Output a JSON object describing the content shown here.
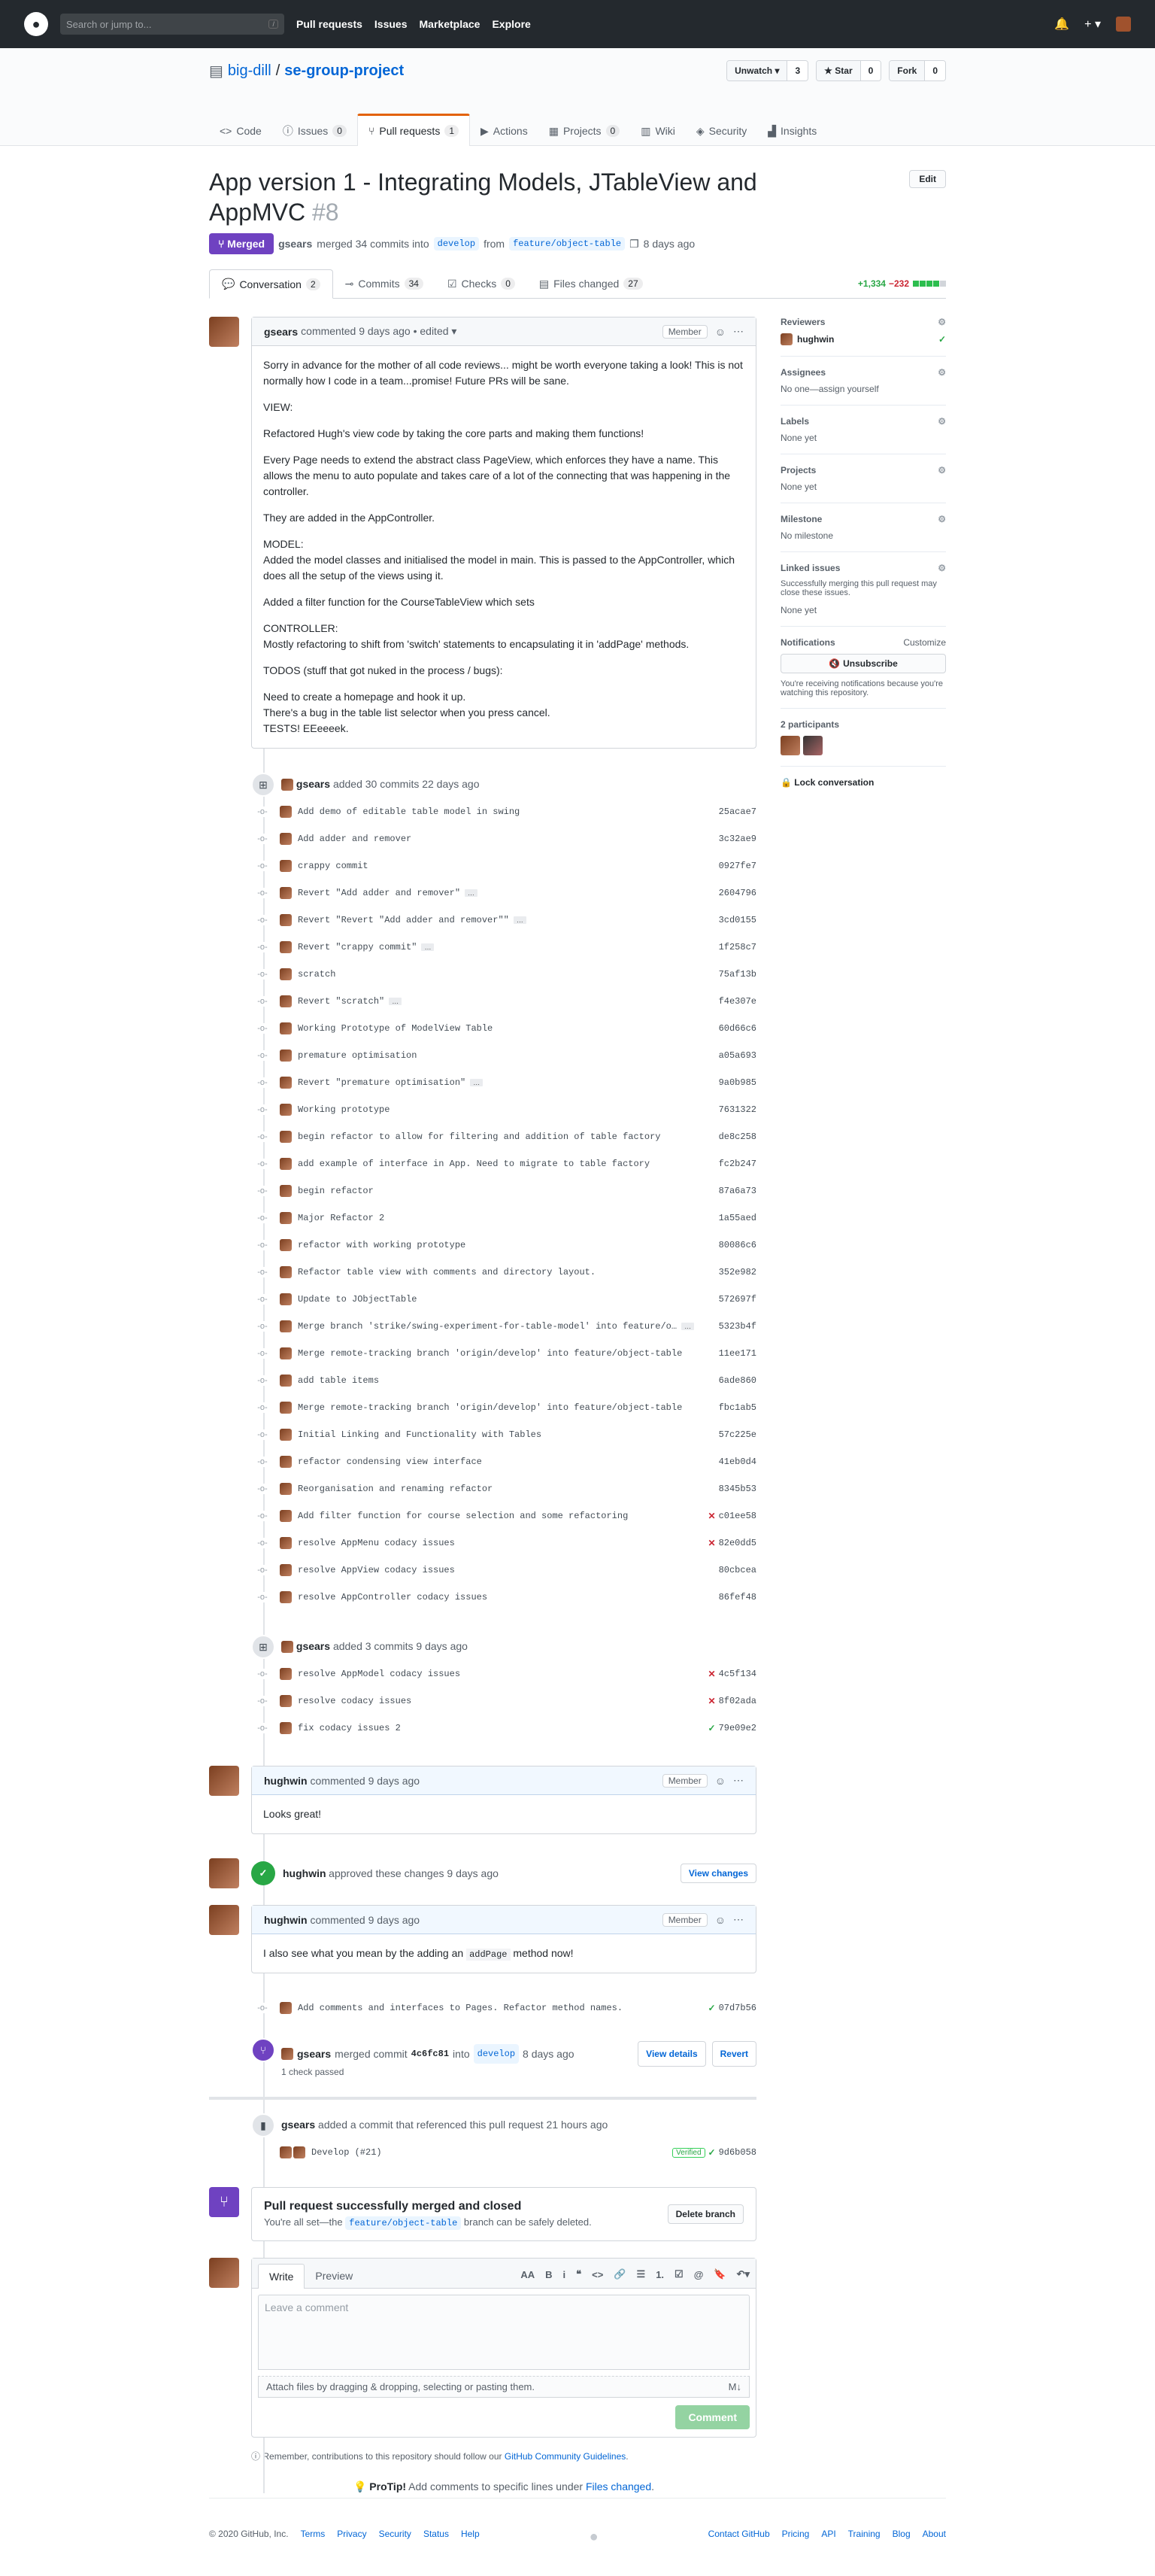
{
  "header": {
    "search_placeholder": "Search or jump to...",
    "search_key": "/",
    "nav": [
      "Pull requests",
      "Issues",
      "Marketplace",
      "Explore"
    ],
    "plus": "+ ▾"
  },
  "repo": {
    "owner": "big-dill",
    "sep": "/",
    "name": "se-group-project",
    "watch_label": "Unwatch ▾",
    "watch_count": "3",
    "star_label": "★ Star",
    "star_count": "0",
    "fork_label": "Fork",
    "fork_count": "0"
  },
  "repo_tabs": [
    {
      "label": "Code",
      "count": ""
    },
    {
      "label": "Issues",
      "count": "0"
    },
    {
      "label": "Pull requests",
      "count": "1"
    },
    {
      "label": "Actions",
      "count": ""
    },
    {
      "label": "Projects",
      "count": "0"
    },
    {
      "label": "Wiki",
      "count": ""
    },
    {
      "label": "Security",
      "count": ""
    },
    {
      "label": "Insights",
      "count": ""
    }
  ],
  "pr": {
    "title": "App version 1 - Integrating Models, JTableView and AppMVC",
    "number": "#8",
    "edit": "Edit",
    "state": "Merged",
    "author": "gsears",
    "merged_text": "merged 34 commits into",
    "base": "develop",
    "from": "from",
    "head": "feature/object-table",
    "ago": "8 days ago"
  },
  "pr_tabs": [
    {
      "label": "Conversation",
      "count": "2"
    },
    {
      "label": "Commits",
      "count": "34"
    },
    {
      "label": "Checks",
      "count": "0"
    },
    {
      "label": "Files changed",
      "count": "27"
    }
  ],
  "diffstat": {
    "add": "+1,334",
    "del": "−232"
  },
  "first_comment": {
    "author": "gsears",
    "meta": "commented 9 days ago • edited ▾",
    "role": "Member",
    "paragraphs": [
      "Sorry in advance for the mother of all code reviews... might be worth everyone taking a look! This is not normally how I code in a team...promise! Future PRs will be sane.",
      "VIEW:",
      "Refactored Hugh's view code by taking the core parts and making them functions!",
      "Every Page needs to extend the abstract class PageView, which enforces they have a name. This allows the menu to auto populate and takes care of a lot of the connecting that was happening in the controller.",
      "They are added in the AppController.",
      "MODEL:\nAdded the model classes and initialised the model in main. This is passed to the AppController, which does all the setup of the views using it.",
      "Added a filter function for the CourseTableView which sets",
      "CONTROLLER:\nMostly refactoring to shift from 'switch' statements to encapsulating it in 'addPage' methods.",
      "TODOS (stuff that got nuked in the process / bugs):",
      "Need to create a homepage and hook it up.\nThere's a bug in the table list selector when you press cancel.\nTESTS! EEeeeek."
    ]
  },
  "commit_group1": {
    "author": "gsears",
    "text": "added 30 commits 22 days ago",
    "commits": [
      {
        "msg": "Add demo of editable table model in swing",
        "ell": false,
        "sha": "25acae7",
        "status": ""
      },
      {
        "msg": "Add adder and remover",
        "ell": false,
        "sha": "3c32ae9",
        "status": ""
      },
      {
        "msg": "crappy commit",
        "ell": false,
        "sha": "0927fe7",
        "status": ""
      },
      {
        "msg": "Revert \"Add adder and remover\"",
        "ell": true,
        "sha": "2604796",
        "status": ""
      },
      {
        "msg": "Revert \"Revert \"Add adder and remover\"\"",
        "ell": true,
        "sha": "3cd0155",
        "status": ""
      },
      {
        "msg": "Revert \"crappy commit\"",
        "ell": true,
        "sha": "1f258c7",
        "status": ""
      },
      {
        "msg": "scratch",
        "ell": false,
        "sha": "75af13b",
        "status": ""
      },
      {
        "msg": "Revert \"scratch\"",
        "ell": true,
        "sha": "f4e307e",
        "status": ""
      },
      {
        "msg": "Working Prototype of ModelView Table",
        "ell": false,
        "sha": "60d66c6",
        "status": ""
      },
      {
        "msg": "premature optimisation",
        "ell": false,
        "sha": "a05a693",
        "status": ""
      },
      {
        "msg": "Revert \"premature optimisation\"",
        "ell": true,
        "sha": "9a0b985",
        "status": ""
      },
      {
        "msg": "Working prototype",
        "ell": false,
        "sha": "7631322",
        "status": ""
      },
      {
        "msg": "begin refactor to allow for filtering and addition of table factory",
        "ell": false,
        "sha": "de8c258",
        "status": ""
      },
      {
        "msg": "add example of interface in App. Need to migrate to table factory",
        "ell": false,
        "sha": "fc2b247",
        "status": ""
      },
      {
        "msg": "begin refactor",
        "ell": false,
        "sha": "87a6a73",
        "status": ""
      },
      {
        "msg": "Major Refactor 2",
        "ell": false,
        "sha": "1a55aed",
        "status": ""
      },
      {
        "msg": "refactor with working prototype",
        "ell": false,
        "sha": "80086c6",
        "status": ""
      },
      {
        "msg": "Refactor table view with comments and directory layout.",
        "ell": false,
        "sha": "352e982",
        "status": ""
      },
      {
        "msg": "Update to JObjectTable",
        "ell": false,
        "sha": "572697f",
        "status": ""
      },
      {
        "msg": "Merge branch 'strike/swing-experiment-for-table-model' into feature/o…",
        "ell": true,
        "sha": "5323b4f",
        "status": ""
      },
      {
        "msg": "Merge remote-tracking branch 'origin/develop' into feature/object-table",
        "ell": false,
        "sha": "11ee171",
        "status": ""
      },
      {
        "msg": "add table items",
        "ell": false,
        "sha": "6ade860",
        "status": ""
      },
      {
        "msg": "Merge remote-tracking branch 'origin/develop' into feature/object-table",
        "ell": false,
        "sha": "fbc1ab5",
        "status": ""
      },
      {
        "msg": "Initial Linking and Functionality with Tables",
        "ell": false,
        "sha": "57c225e",
        "status": ""
      },
      {
        "msg": "refactor condensing view interface",
        "ell": false,
        "sha": "41eb0d4",
        "status": ""
      },
      {
        "msg": "Reorganisation and renaming refactor",
        "ell": false,
        "sha": "8345b53",
        "status": ""
      },
      {
        "msg": "Add filter function for course selection and some refactoring",
        "ell": false,
        "sha": "c01ee58",
        "status": "fail"
      },
      {
        "msg": "resolve AppMenu codacy issues",
        "ell": false,
        "sha": "82e0dd5",
        "status": "fail"
      },
      {
        "msg": "resolve AppView codacy issues",
        "ell": false,
        "sha": "80cbcea",
        "status": ""
      },
      {
        "msg": "resolve AppController codacy issues",
        "ell": false,
        "sha": "86fef48",
        "status": ""
      }
    ]
  },
  "commit_group2": {
    "author": "gsears",
    "text": "added 3 commits 9 days ago",
    "commits": [
      {
        "msg": "resolve AppModel codacy issues",
        "ell": false,
        "sha": "4c5f134",
        "status": "fail"
      },
      {
        "msg": "resolve codacy issues",
        "ell": false,
        "sha": "8f02ada",
        "status": "fail"
      },
      {
        "msg": "fix codacy issues 2",
        "ell": false,
        "sha": "79e09e2",
        "status": "ok"
      }
    ]
  },
  "comment2": {
    "author": "hughwin",
    "meta": "commented 9 days ago",
    "role": "Member",
    "body": "Looks great!"
  },
  "approval": {
    "author": "hughwin",
    "text": "approved these changes 9 days ago",
    "button": "View changes"
  },
  "comment3": {
    "author": "hughwin",
    "meta": "commented 9 days ago",
    "role": "Member",
    "body_pre": "I also see what you mean by the adding an",
    "body_code": "addPage",
    "body_post": "method now!"
  },
  "late_commit": {
    "msg": "Add comments and interfaces to Pages. Refactor method names.",
    "sha": "07d7b56"
  },
  "merge_event": {
    "author": "gsears",
    "text": "merged commit",
    "sha": "4c6fc81",
    "into": "into",
    "base": "develop",
    "ago": "8 days ago",
    "checks": "1 check passed",
    "view": "View details",
    "revert": "Revert"
  },
  "ref_event": {
    "author": "gsears",
    "text": "added a commit that referenced this pull request 21 hours ago",
    "msg": "Develop (#21)",
    "verified": "Verified",
    "sha": "9d6b058"
  },
  "merged_box": {
    "title": "Pull request successfully merged and closed",
    "pre": "You're all set—the",
    "branch": "feature/object-table",
    "post": "branch can be safely deleted.",
    "button": "Delete branch"
  },
  "editor": {
    "write": "Write",
    "preview": "Preview",
    "tools": [
      "AA",
      "B",
      "i",
      "❝",
      "<>",
      "🔗",
      "☰",
      "1.",
      "☑",
      "@",
      "🔖",
      "↶▾"
    ],
    "placeholder": "Leave a comment",
    "attach": "Attach files by dragging & dropping, selecting or pasting them.",
    "md": "M↓",
    "submit": "Comment"
  },
  "guidelines": {
    "pre": "Remember, contributions to this repository should follow our",
    "link": "GitHub Community Guidelines",
    "post": "."
  },
  "protip": {
    "label": "ProTip!",
    "pre": "Add comments to specific lines under",
    "link": "Files changed",
    "post": "."
  },
  "sidebar": {
    "reviewers": "Reviewers",
    "reviewer_name": "hughwin",
    "assignees": "Assignees",
    "assignees_val": "No one—assign yourself",
    "labels": "Labels",
    "labels_val": "None yet",
    "projects": "Projects",
    "projects_val": "None yet",
    "milestone": "Milestone",
    "milestone_val": "No milestone",
    "linked": "Linked issues",
    "linked_desc": "Successfully merging this pull request may close these issues.",
    "linked_val": "None yet",
    "notifications": "Notifications",
    "customize": "Customize",
    "unsubscribe": "Unsubscribe",
    "notif_desc": "You're receiving notifications because you're watching this repository.",
    "participants": "2 participants",
    "lock": "Lock conversation"
  },
  "footer": {
    "copyright": "© 2020 GitHub, Inc.",
    "left": [
      "Terms",
      "Privacy",
      "Security",
      "Status",
      "Help"
    ],
    "right": [
      "Contact GitHub",
      "Pricing",
      "API",
      "Training",
      "Blog",
      "About"
    ]
  }
}
